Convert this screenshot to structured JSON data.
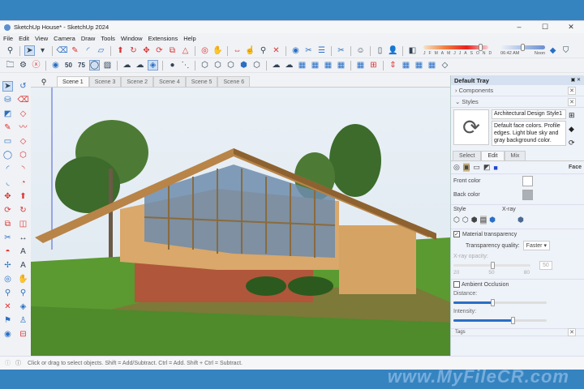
{
  "window": {
    "title": "SketchUp House* - SketchUp 2024",
    "minimize": "–",
    "maximize": "☐",
    "close": "✕"
  },
  "menu": [
    "File",
    "Edit",
    "View",
    "Camera",
    "Draw",
    "Tools",
    "Window",
    "Extensions",
    "Help"
  ],
  "shadow": {
    "months": [
      "J",
      "F",
      "M",
      "A",
      "M",
      "J",
      "J",
      "A",
      "S",
      "O",
      "N",
      "D"
    ],
    "month_fraction": 0.85,
    "time": "06:42 AM",
    "noon": "Noon",
    "time_fraction": 0.5
  },
  "toolbar2_labels": {
    "lod50": "50",
    "lod75": "75"
  },
  "scenes": {
    "tabs": [
      "Scene 1",
      "Scene 3",
      "Scene 2",
      "Scene 4",
      "Scene 5",
      "Scene 6"
    ],
    "active": 0
  },
  "tray": {
    "title": "Default Tray",
    "components": "Components",
    "styles": "Styles",
    "style_name": "Architectural Design Style1",
    "style_desc": "Default face colors. Profile edges. Light blue sky and gray background color.",
    "tabs": [
      "Select",
      "Edit",
      "Mix"
    ],
    "active_tab": 1,
    "face_label": "Face",
    "front_color_label": "Front color",
    "front_color": "#ffffff",
    "back_color_label": "Back color",
    "back_color": "#a9b0b6",
    "style_label": "Style",
    "xray_label": "X-ray",
    "material_transparency": "Material transparency",
    "material_transparency_checked": true,
    "transparency_quality_label": "Transparency quality:",
    "transparency_quality": "Faster",
    "xray_opacity_label": "X-ray opacity:",
    "xray_opacity": "50",
    "xray_ticks": [
      "20",
      "50",
      "80"
    ],
    "ambient_occlusion": "Ambient Occlusion",
    "distance_label": "Distance:",
    "distance_value": 0.42,
    "intensity_label": "Intensity:",
    "intensity_value": 0.63,
    "tags": "Tags"
  },
  "status": {
    "message": "Click or drag to select objects. Shift = Add/Subtract. Ctrl = Add. Shift + Ctrl = Subtract."
  },
  "watermark": "www.MyFileCR.com"
}
